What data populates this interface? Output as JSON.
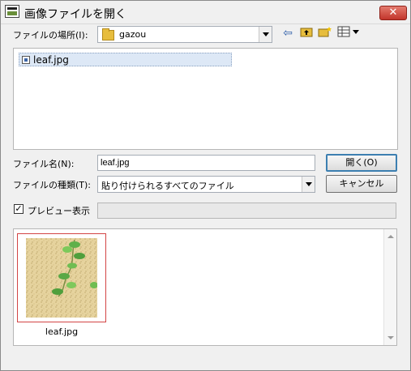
{
  "window": {
    "title": "画像ファイルを開く",
    "close_label": "✕"
  },
  "location": {
    "label": "ファイルの場所(I):",
    "folder": "gazou"
  },
  "toolbar": {
    "back_icon": "back-arrow-icon",
    "up_icon": "up-folder-icon",
    "new_folder_icon": "new-folder-icon",
    "view_icon": "view-menu-icon"
  },
  "file_list": {
    "items": [
      {
        "name": "leaf.jpg"
      }
    ]
  },
  "filename": {
    "label": "ファイル名(N):",
    "value": "leaf.jpg"
  },
  "filetype": {
    "label": "ファイルの種類(T):",
    "value": "貼り付けられるすべてのファイル"
  },
  "buttons": {
    "open": "開く(O)",
    "cancel": "キャンセル"
  },
  "preview": {
    "checkbox_label": "プレビュー表示",
    "checked": true
  },
  "thumbnails": {
    "items": [
      {
        "caption": "leaf.jpg"
      }
    ]
  }
}
